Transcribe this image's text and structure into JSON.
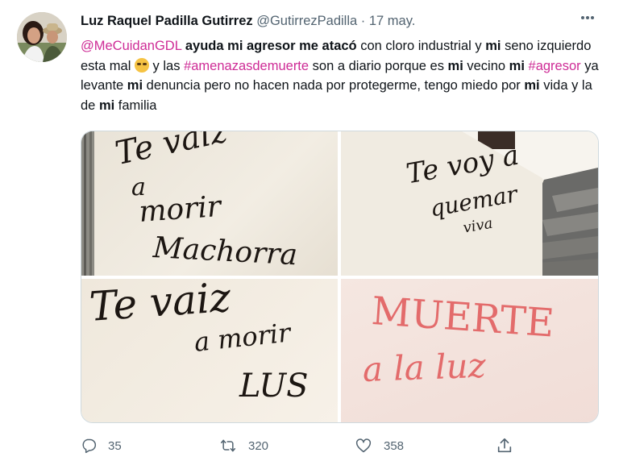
{
  "tweet": {
    "author_name": "Luz Raquel Padilla Gutirrez",
    "handle": "@GutirrezPadilla",
    "separator": "·",
    "date": "17 may.",
    "more_icon": "more-icon",
    "text": {
      "mention": "@MeCuidanGDL",
      "p1": " ",
      "b1": "ayuda mi agresor me atacó",
      "p2": " con cloro industrial y ",
      "b2": "mi",
      "p3": " seno izquierdo esta mal ",
      "emoji_icon": "sad-face-emoji",
      "p4": " y las ",
      "hashtag1": "#amenazasdemuerte",
      "p5": " son a diario porque es ",
      "b3": "mi",
      "p6": " vecino ",
      "b4": "mi",
      "p7": " ",
      "hashtag2": "#agresor",
      "p8": " ya levante ",
      "b5": "mi",
      "p9": " denuncia pero no hacen nada por protegerme, tengo miedo por ",
      "b6": "mi",
      "p10": " vida y la de ",
      "b7": "mi",
      "p11": " familia"
    }
  },
  "media": {
    "photo1": {
      "line1": "Te vaiz",
      "line2": "a",
      "line3": "morir",
      "line4": "Machorra"
    },
    "photo2": {
      "line1": "Te voy a",
      "line2": "quemar",
      "line3": "viva"
    },
    "photo3": {
      "line1": "Te vaiz",
      "line2": "a morir",
      "line3": "LUS"
    },
    "photo4": {
      "line1": "MUERTE",
      "line2": "a la luz",
      "ink_color": "#e36b6b"
    }
  },
  "actions": {
    "reply_count": "35",
    "retweet_count": "320",
    "like_count": "358",
    "reply_icon": "reply-icon",
    "retweet_icon": "retweet-icon",
    "like_icon": "heart-icon",
    "share_icon": "share-icon"
  },
  "colors": {
    "link": "#ce2c96",
    "secondary_text": "#536471",
    "primary_text": "#0f1419"
  }
}
